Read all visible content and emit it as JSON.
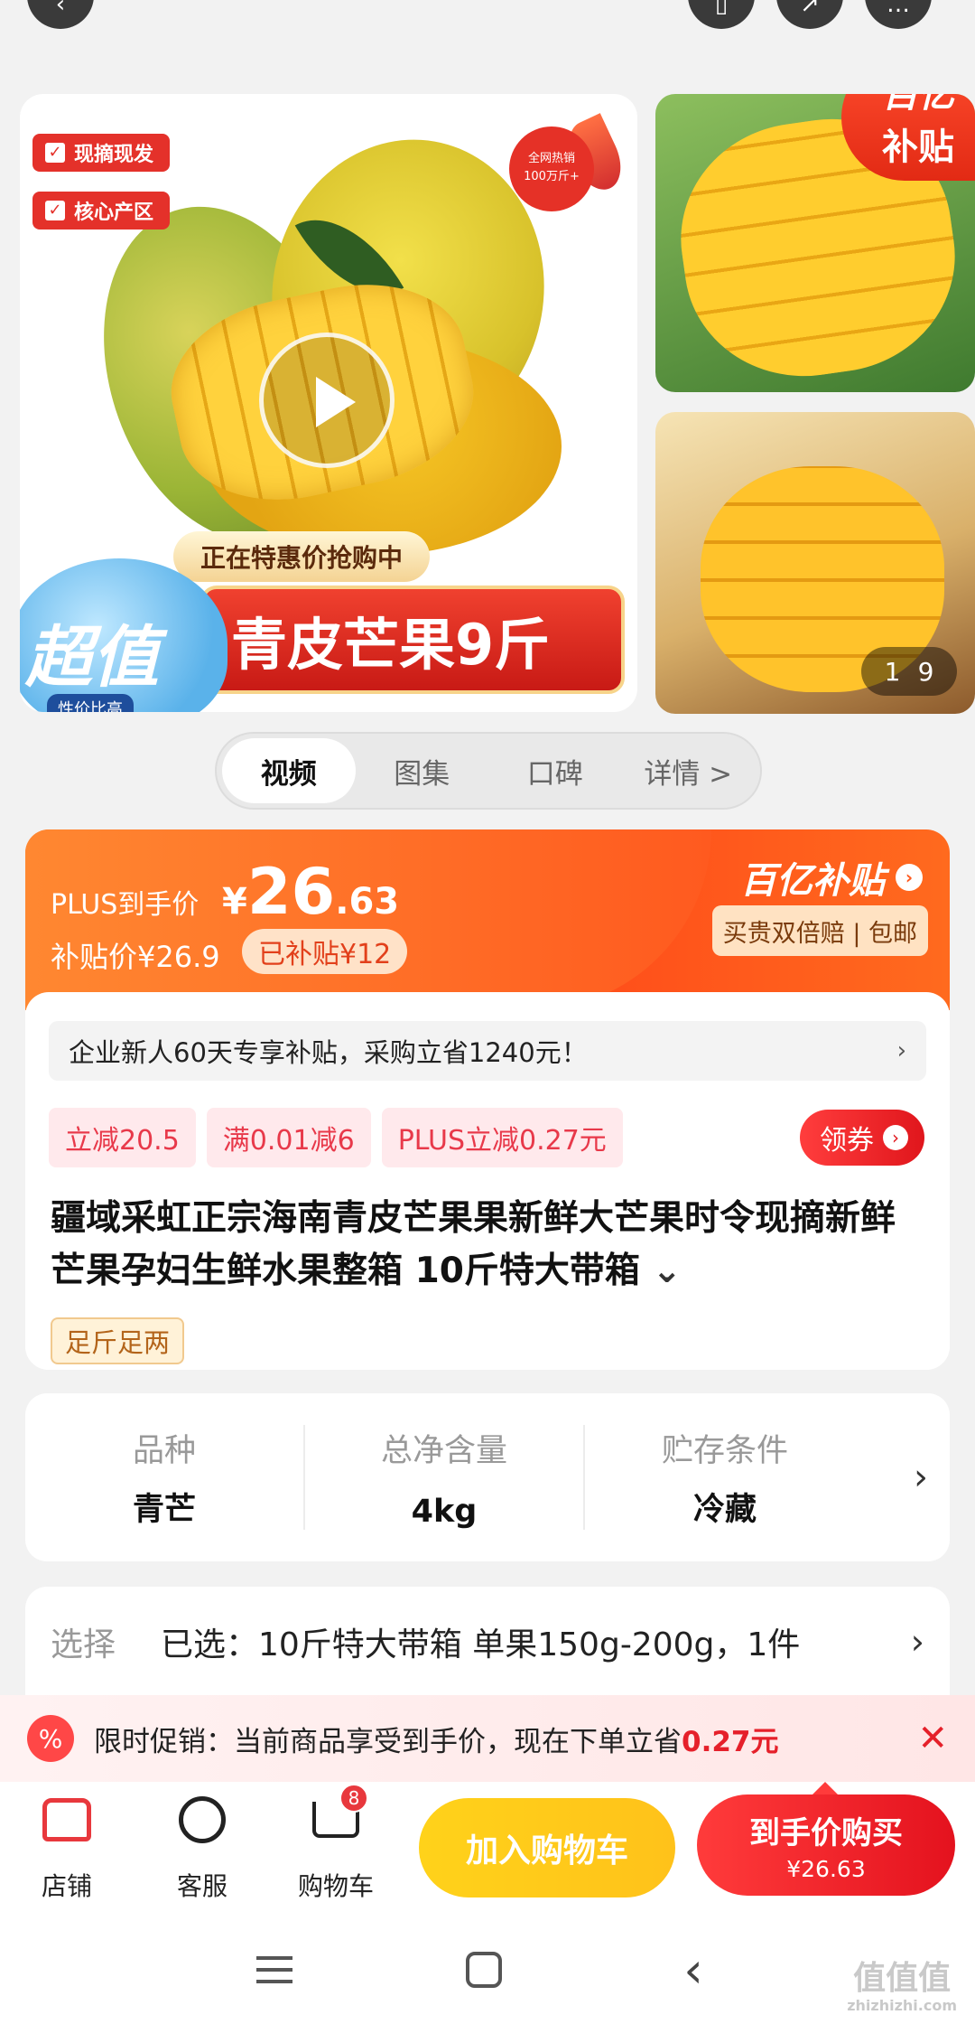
{
  "top_actions": {
    "back_icon": "back-arrow-icon",
    "fav_icon": "bookmark-icon",
    "share_icon": "share-icon",
    "more_icon": "more-icon"
  },
  "gallery": {
    "tag1": "现摘现发",
    "tag2": "核心产区",
    "hot_badge_line1": "全网热销",
    "hot_badge_line2": "100万斤+",
    "banner_sub": "正在特惠价抢购中",
    "banner_main": "青皮芒果9斤",
    "cloud_main": "超值",
    "cloud_sub": "性价比高",
    "subsidy_line1": "百亿",
    "subsidy_line2": "补贴",
    "page_current": "1",
    "page_total": "9"
  },
  "media_tabs": [
    "视频",
    "图集",
    "口碑",
    "详情 >"
  ],
  "price": {
    "plus_label": "PLUS到手价",
    "currency": "¥",
    "integer": "26",
    "decimal": ".63",
    "subsidy_price": "补贴价¥26.9",
    "subsidy_saved": "已补贴¥12",
    "program_name": "百亿补贴",
    "program_tags": "买贵双倍赔 | 包邮"
  },
  "notice": "企业新人60天专享补贴，采购立省1240元！",
  "coupons": [
    "立减20.5",
    "满0.01减6",
    "PLUS立减0.27元"
  ],
  "claim_button": "领券",
  "product_title": "疆域采虹正宗海南青皮芒果果新鲜大芒果时令现摘新鲜芒果孕妇生鲜水果整箱 10斤特大带箱",
  "tag_full": "足斤足两",
  "specs": [
    {
      "key": "品种",
      "value": "青芒"
    },
    {
      "key": "总净含量",
      "value": "4kg"
    },
    {
      "key": "贮存条件",
      "value": "冷藏"
    }
  ],
  "select": {
    "label": "选择",
    "value": "已选：10斤特大带箱 单果150g-200g，1件"
  },
  "promo": {
    "icon": "%",
    "text": "限时促销：当前商品享受到手价，现在下单立省",
    "amount": "0.27元"
  },
  "bottom": {
    "store": "店铺",
    "service": "客服",
    "cart": "购物车",
    "cart_count": "8",
    "add_cart": "加入购物车",
    "buy_label": "到手价购买",
    "buy_price": "¥26.63"
  },
  "watermark": {
    "big": "值值值",
    "small": "zhizhizhi.com"
  },
  "colors": {
    "accent_red": "#e4121e",
    "accent_orange": "#ff5a1f",
    "add_cart_yellow": "#ffc21a"
  }
}
